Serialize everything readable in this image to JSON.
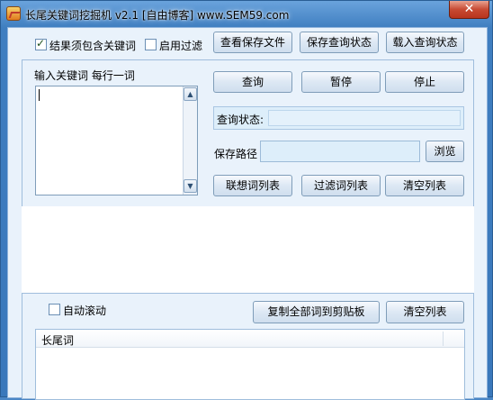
{
  "window": {
    "title": "长尾关键词挖掘机 v2.1 [自由博客] www.SEM59.com",
    "close_glyph": "✕"
  },
  "options": {
    "must_contain_label": "结果须包含关键词",
    "must_contain_checked": true,
    "enable_filter_label": "启用过滤",
    "enable_filter_checked": false
  },
  "top_buttons": {
    "view_saved": "查看保存文件",
    "save_state": "保存查询状态",
    "load_state": "载入查询状态"
  },
  "keywords": {
    "label": "输入关键词  每行一词",
    "value": ""
  },
  "actions": {
    "query": "查询",
    "pause": "暂停",
    "stop": "停止"
  },
  "status": {
    "label": "查询状态:",
    "value": ""
  },
  "save_path": {
    "label": "保存路径",
    "value": "",
    "browse": "浏览"
  },
  "list_buttons": {
    "suggest_list": "联想词列表",
    "filter_list": "过滤词列表",
    "clear_list": "清空列表"
  },
  "results": {
    "auto_scroll_label": "自动滚动",
    "auto_scroll_checked": false,
    "copy_all": "复制全部词到剪贴板",
    "clear_list": "清空列表",
    "columns": [
      "长尾词"
    ]
  },
  "colors": {
    "frame": "#4a86c5",
    "client_bg": "#e9f2fb",
    "close_red": "#c74a33"
  },
  "icons": {
    "scroll_up": "▲",
    "scroll_down": "▼"
  }
}
